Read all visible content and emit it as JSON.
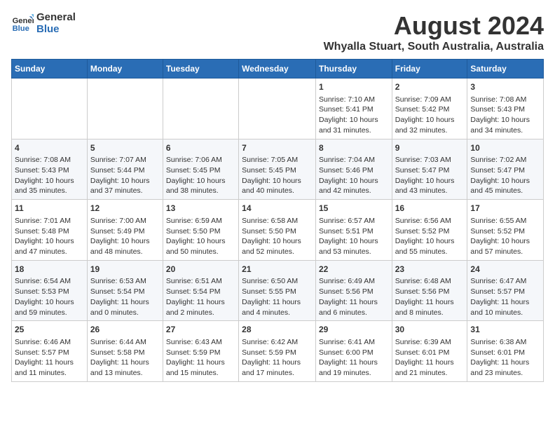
{
  "header": {
    "logo_line1": "General",
    "logo_line2": "Blue",
    "main_title": "August 2024",
    "sub_title": "Whyalla Stuart, South Australia, Australia"
  },
  "days_of_week": [
    "Sunday",
    "Monday",
    "Tuesday",
    "Wednesday",
    "Thursday",
    "Friday",
    "Saturday"
  ],
  "weeks": [
    [
      {
        "day": "",
        "detail": ""
      },
      {
        "day": "",
        "detail": ""
      },
      {
        "day": "",
        "detail": ""
      },
      {
        "day": "",
        "detail": ""
      },
      {
        "day": "1",
        "detail": "Sunrise: 7:10 AM\nSunset: 5:41 PM\nDaylight: 10 hours\nand 31 minutes."
      },
      {
        "day": "2",
        "detail": "Sunrise: 7:09 AM\nSunset: 5:42 PM\nDaylight: 10 hours\nand 32 minutes."
      },
      {
        "day": "3",
        "detail": "Sunrise: 7:08 AM\nSunset: 5:43 PM\nDaylight: 10 hours\nand 34 minutes."
      }
    ],
    [
      {
        "day": "4",
        "detail": "Sunrise: 7:08 AM\nSunset: 5:43 PM\nDaylight: 10 hours\nand 35 minutes."
      },
      {
        "day": "5",
        "detail": "Sunrise: 7:07 AM\nSunset: 5:44 PM\nDaylight: 10 hours\nand 37 minutes."
      },
      {
        "day": "6",
        "detail": "Sunrise: 7:06 AM\nSunset: 5:45 PM\nDaylight: 10 hours\nand 38 minutes."
      },
      {
        "day": "7",
        "detail": "Sunrise: 7:05 AM\nSunset: 5:45 PM\nDaylight: 10 hours\nand 40 minutes."
      },
      {
        "day": "8",
        "detail": "Sunrise: 7:04 AM\nSunset: 5:46 PM\nDaylight: 10 hours\nand 42 minutes."
      },
      {
        "day": "9",
        "detail": "Sunrise: 7:03 AM\nSunset: 5:47 PM\nDaylight: 10 hours\nand 43 minutes."
      },
      {
        "day": "10",
        "detail": "Sunrise: 7:02 AM\nSunset: 5:47 PM\nDaylight: 10 hours\nand 45 minutes."
      }
    ],
    [
      {
        "day": "11",
        "detail": "Sunrise: 7:01 AM\nSunset: 5:48 PM\nDaylight: 10 hours\nand 47 minutes."
      },
      {
        "day": "12",
        "detail": "Sunrise: 7:00 AM\nSunset: 5:49 PM\nDaylight: 10 hours\nand 48 minutes."
      },
      {
        "day": "13",
        "detail": "Sunrise: 6:59 AM\nSunset: 5:50 PM\nDaylight: 10 hours\nand 50 minutes."
      },
      {
        "day": "14",
        "detail": "Sunrise: 6:58 AM\nSunset: 5:50 PM\nDaylight: 10 hours\nand 52 minutes."
      },
      {
        "day": "15",
        "detail": "Sunrise: 6:57 AM\nSunset: 5:51 PM\nDaylight: 10 hours\nand 53 minutes."
      },
      {
        "day": "16",
        "detail": "Sunrise: 6:56 AM\nSunset: 5:52 PM\nDaylight: 10 hours\nand 55 minutes."
      },
      {
        "day": "17",
        "detail": "Sunrise: 6:55 AM\nSunset: 5:52 PM\nDaylight: 10 hours\nand 57 minutes."
      }
    ],
    [
      {
        "day": "18",
        "detail": "Sunrise: 6:54 AM\nSunset: 5:53 PM\nDaylight: 10 hours\nand 59 minutes."
      },
      {
        "day": "19",
        "detail": "Sunrise: 6:53 AM\nSunset: 5:54 PM\nDaylight: 11 hours\nand 0 minutes."
      },
      {
        "day": "20",
        "detail": "Sunrise: 6:51 AM\nSunset: 5:54 PM\nDaylight: 11 hours\nand 2 minutes."
      },
      {
        "day": "21",
        "detail": "Sunrise: 6:50 AM\nSunset: 5:55 PM\nDaylight: 11 hours\nand 4 minutes."
      },
      {
        "day": "22",
        "detail": "Sunrise: 6:49 AM\nSunset: 5:56 PM\nDaylight: 11 hours\nand 6 minutes."
      },
      {
        "day": "23",
        "detail": "Sunrise: 6:48 AM\nSunset: 5:56 PM\nDaylight: 11 hours\nand 8 minutes."
      },
      {
        "day": "24",
        "detail": "Sunrise: 6:47 AM\nSunset: 5:57 PM\nDaylight: 11 hours\nand 10 minutes."
      }
    ],
    [
      {
        "day": "25",
        "detail": "Sunrise: 6:46 AM\nSunset: 5:57 PM\nDaylight: 11 hours\nand 11 minutes."
      },
      {
        "day": "26",
        "detail": "Sunrise: 6:44 AM\nSunset: 5:58 PM\nDaylight: 11 hours\nand 13 minutes."
      },
      {
        "day": "27",
        "detail": "Sunrise: 6:43 AM\nSunset: 5:59 PM\nDaylight: 11 hours\nand 15 minutes."
      },
      {
        "day": "28",
        "detail": "Sunrise: 6:42 AM\nSunset: 5:59 PM\nDaylight: 11 hours\nand 17 minutes."
      },
      {
        "day": "29",
        "detail": "Sunrise: 6:41 AM\nSunset: 6:00 PM\nDaylight: 11 hours\nand 19 minutes."
      },
      {
        "day": "30",
        "detail": "Sunrise: 6:39 AM\nSunset: 6:01 PM\nDaylight: 11 hours\nand 21 minutes."
      },
      {
        "day": "31",
        "detail": "Sunrise: 6:38 AM\nSunset: 6:01 PM\nDaylight: 11 hours\nand 23 minutes."
      }
    ]
  ]
}
